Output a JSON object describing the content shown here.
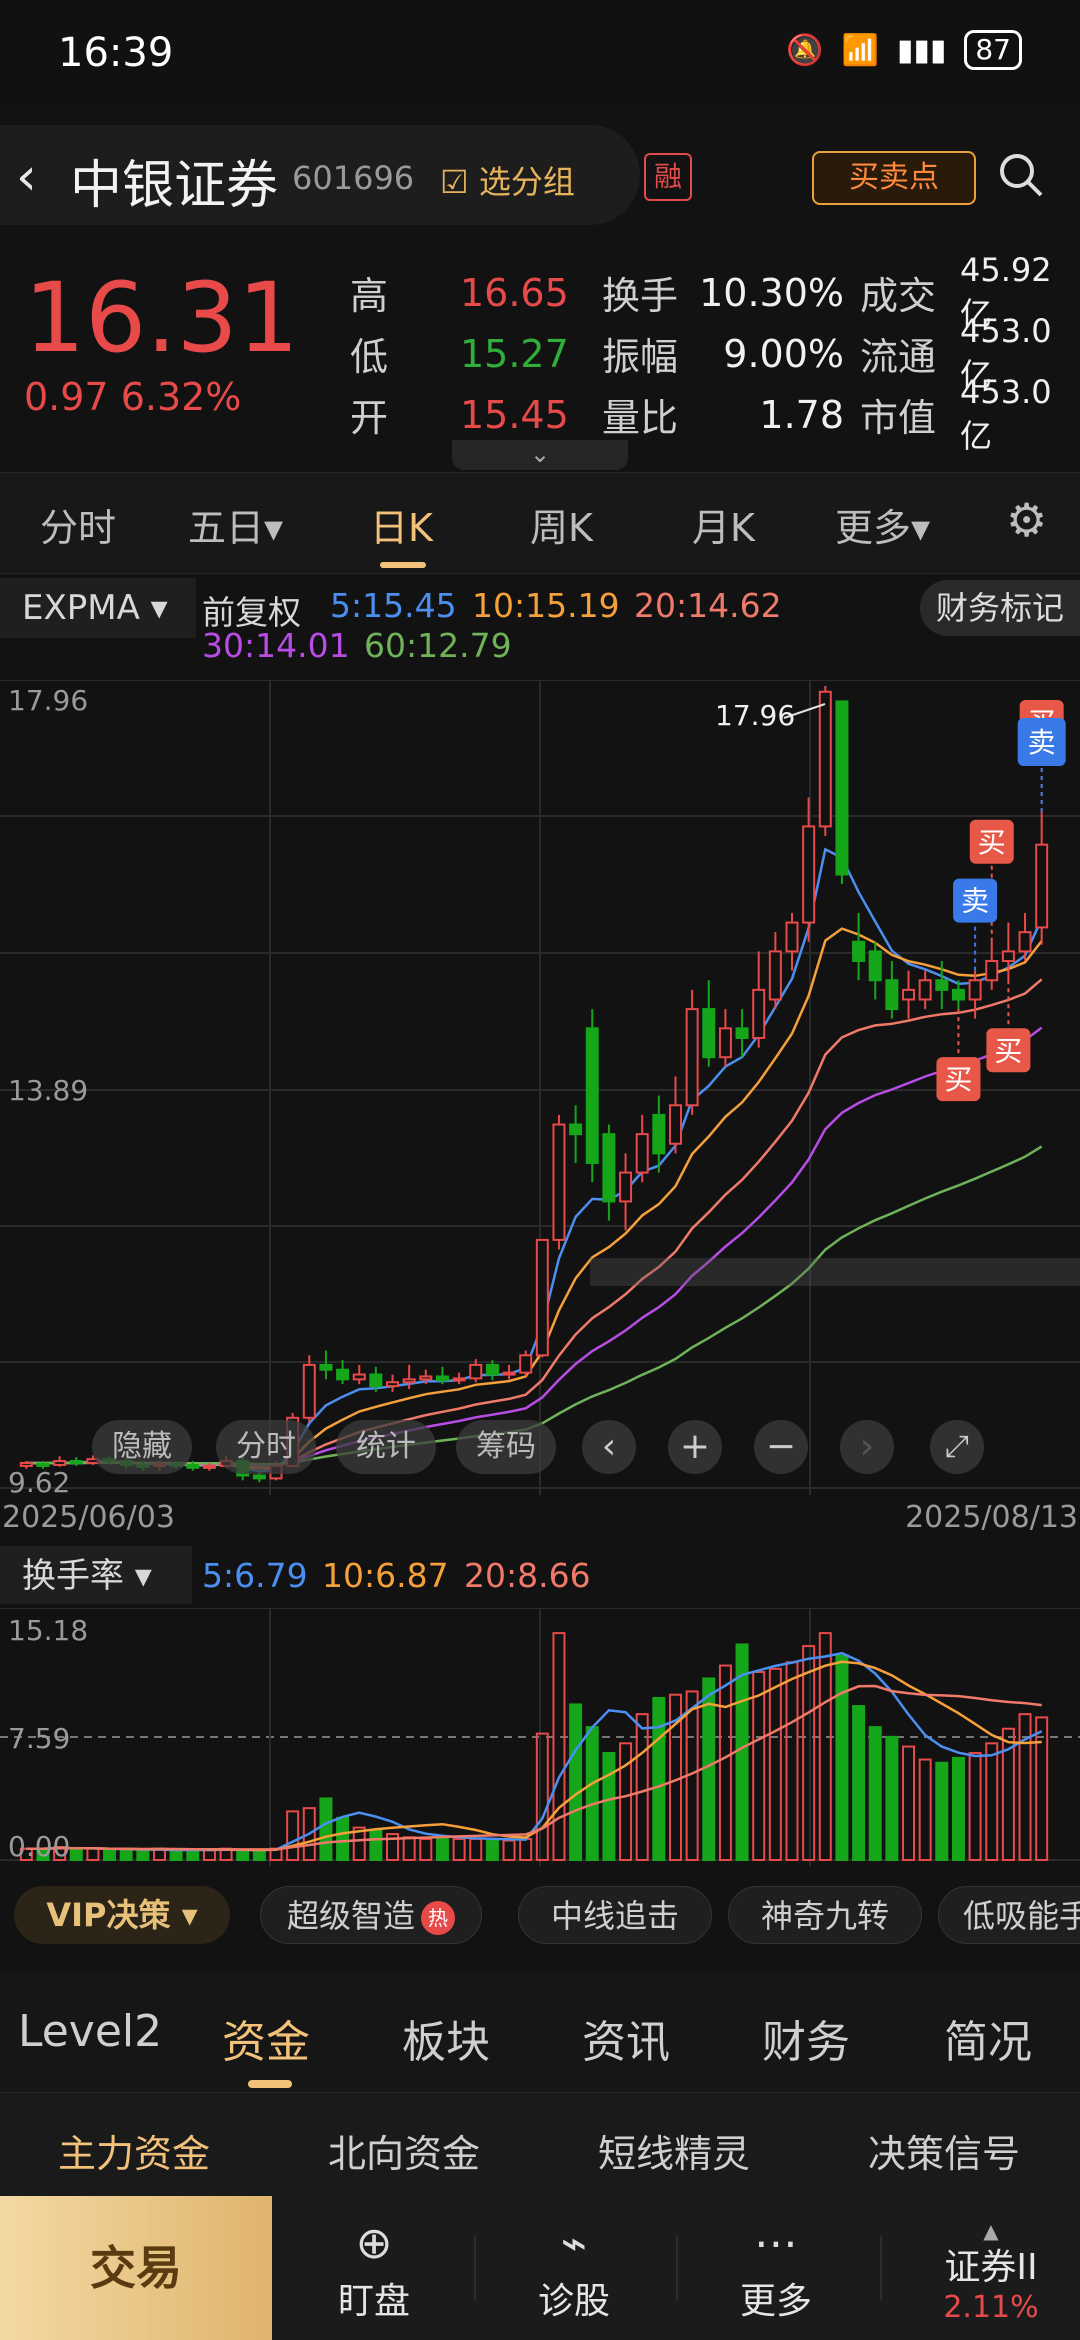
{
  "status": {
    "time": "16:39",
    "battery": "87"
  },
  "header": {
    "name": "中银证券",
    "code": "601696",
    "group": "选分组",
    "rong": "融",
    "bsp": "买卖点"
  },
  "quote": {
    "price": "16.31",
    "change": "0.97 6.32%",
    "rows": [
      {
        "l1": "高",
        "v1": "16.65",
        "l2": "换手",
        "v2": "10.30%",
        "l3": "成交",
        "v3": "45.92亿"
      },
      {
        "l1": "低",
        "v1": "15.27",
        "l2": "振幅",
        "v2": "9.00%",
        "l3": "流通",
        "v3": "453.0亿"
      },
      {
        "l1": "开",
        "v1": "15.45",
        "l2": "量比",
        "v2": "1.78",
        "l3": "市值",
        "v3": "453.0亿"
      }
    ]
  },
  "tabs": [
    "分时",
    "五日▾",
    "日K",
    "周K",
    "月K",
    "更多▾"
  ],
  "legend": {
    "indicator": "EXPMA ▾",
    "adjust": "前复权",
    "ma5": "5:15.45",
    "ma10": "10:15.19",
    "ma20": "20:14.62",
    "ma30": "30:14.01",
    "ma60": "60:12.79",
    "fin_mark": "财务标记"
  },
  "chart_labels": {
    "y_top": "17.96",
    "y_mid": "13.89",
    "y_low": "9.62",
    "peak": "17.96"
  },
  "chart_tools": {
    "hide": "隐藏",
    "timeshare": "分时",
    "stats": "统计",
    "chips": "筹码"
  },
  "signals": {
    "buy": "买",
    "sell": "卖"
  },
  "dates": {
    "start": "2025/06/03",
    "end": "2025/08/13"
  },
  "turnover": {
    "indicator": "换手率 ▾",
    "ma5": "5:6.79",
    "ma10": "10:6.87",
    "ma20": "20:8.66",
    "y_top": "15.18",
    "y_mid": "7.59",
    "y_low": "0.00"
  },
  "pills": {
    "vip": "VIP决策 ▾",
    "p1": "超级智造",
    "hot": "热",
    "p2": "中线追击",
    "p3": "神奇九转",
    "p4": "低吸能手"
  },
  "sections": [
    "Level2",
    "资金",
    "板块",
    "资讯",
    "财务",
    "简况"
  ],
  "subtabs": [
    "主力资金",
    "北向资金",
    "短线精灵",
    "决策信号"
  ],
  "bottom": {
    "trade": "交易",
    "watch": "盯盘",
    "diag": "诊股",
    "more": "更多",
    "broker": "证券II",
    "broker_pct": "2.11%"
  },
  "colors": {
    "up": "#e84a4a",
    "down": "#15a61a",
    "accent": "#f3c27a",
    "ma5": "#4b8ff0",
    "ma10": "#f5a03a",
    "ma20": "#f07a6a",
    "ma30": "#b84de6",
    "ma60": "#6fb25a"
  },
  "chart_data": [
    {
      "type": "candlestick",
      "title": "",
      "ylim": [
        9.62,
        17.96
      ],
      "x_range": [
        "2025/06/03",
        "2025/08/13"
      ],
      "candles": [
        [
          9.85,
          9.88,
          9.82,
          9.9
        ],
        [
          9.87,
          9.86,
          9.82,
          9.9
        ],
        [
          9.86,
          9.9,
          9.84,
          9.95
        ],
        [
          9.9,
          9.88,
          9.85,
          9.94
        ],
        [
          9.88,
          9.92,
          9.86,
          9.96
        ],
        [
          9.92,
          9.9,
          9.86,
          9.95
        ],
        [
          9.9,
          9.86,
          9.82,
          9.93
        ],
        [
          9.86,
          9.85,
          9.8,
          9.9
        ],
        [
          9.85,
          9.87,
          9.8,
          9.9
        ],
        [
          9.87,
          9.86,
          9.82,
          9.9
        ],
        [
          9.86,
          9.83,
          9.8,
          9.9
        ],
        [
          9.83,
          9.85,
          9.8,
          9.88
        ],
        [
          9.85,
          9.9,
          9.83,
          9.95
        ],
        [
          9.9,
          9.75,
          9.7,
          9.94
        ],
        [
          9.75,
          9.72,
          9.68,
          9.8
        ],
        [
          9.72,
          9.85,
          9.7,
          9.9
        ],
        [
          9.85,
          10.35,
          9.84,
          10.4
        ],
        [
          10.35,
          10.9,
          10.3,
          11.0
        ],
        [
          10.9,
          10.85,
          10.75,
          11.05
        ],
        [
          10.85,
          10.75,
          10.7,
          10.95
        ],
        [
          10.75,
          10.8,
          10.7,
          10.9
        ],
        [
          10.8,
          10.68,
          10.62,
          10.88
        ],
        [
          10.68,
          10.72,
          10.62,
          10.8
        ],
        [
          10.72,
          10.75,
          10.65,
          10.9
        ],
        [
          10.75,
          10.78,
          10.7,
          10.85
        ],
        [
          10.78,
          10.74,
          10.7,
          10.88
        ],
        [
          10.74,
          10.76,
          10.7,
          10.82
        ],
        [
          10.76,
          10.9,
          10.72,
          10.96
        ],
        [
          10.9,
          10.8,
          10.74,
          10.95
        ],
        [
          10.8,
          10.82,
          10.75,
          10.9
        ],
        [
          10.82,
          11.0,
          10.78,
          11.05
        ],
        [
          11.0,
          12.2,
          10.98,
          12.2
        ],
        [
          12.2,
          13.4,
          12.1,
          13.5
        ],
        [
          13.4,
          13.3,
          13.0,
          13.6
        ],
        [
          14.4,
          13.0,
          12.8,
          14.6
        ],
        [
          13.3,
          12.6,
          12.4,
          13.4
        ],
        [
          12.6,
          12.9,
          12.3,
          13.1
        ],
        [
          12.9,
          13.3,
          12.8,
          13.5
        ],
        [
          13.5,
          13.1,
          12.9,
          13.7
        ],
        [
          13.2,
          13.6,
          13.1,
          13.9
        ],
        [
          13.6,
          14.6,
          13.5,
          14.8
        ],
        [
          14.6,
          14.1,
          14.0,
          14.9
        ],
        [
          14.1,
          14.4,
          14.0,
          14.6
        ],
        [
          14.4,
          14.3,
          14.1,
          14.6
        ],
        [
          14.3,
          14.8,
          14.2,
          15.2
        ],
        [
          14.7,
          15.2,
          14.6,
          15.4
        ],
        [
          15.2,
          15.5,
          15.0,
          15.6
        ],
        [
          15.5,
          16.5,
          15.3,
          16.8
        ],
        [
          16.5,
          17.9,
          16.4,
          17.96
        ],
        [
          17.8,
          16.0,
          15.9,
          17.2
        ],
        [
          15.3,
          15.1,
          14.9,
          15.6
        ],
        [
          15.2,
          14.9,
          14.7,
          15.3
        ],
        [
          14.9,
          14.6,
          14.5,
          15.1
        ],
        [
          14.7,
          14.8,
          14.5,
          15.0
        ],
        [
          14.7,
          14.9,
          14.6,
          15.0
        ],
        [
          14.9,
          14.8,
          14.6,
          15.1
        ],
        [
          14.8,
          14.7,
          14.6,
          14.9
        ],
        [
          14.7,
          14.9,
          14.5,
          15.0
        ],
        [
          14.9,
          15.1,
          14.8,
          15.3
        ],
        [
          15.1,
          15.2,
          14.9,
          15.5
        ],
        [
          15.2,
          15.4,
          15.1,
          15.6
        ],
        [
          15.45,
          16.31,
          15.27,
          16.65
        ]
      ],
      "markers": [
        {
          "label": "买",
          "index": 50
        },
        {
          "label": "买",
          "index": 55
        },
        {
          "label": "买",
          "index": 57
        },
        {
          "label": "买",
          "index": 58
        },
        {
          "label": "卖",
          "index": 61
        },
        {
          "label": "卖",
          "index": 57
        }
      ]
    },
    {
      "type": "bar",
      "title": "",
      "ylabel": "",
      "ylim": [
        0,
        15.18
      ],
      "values": [
        0.7,
        0.7,
        0.8,
        0.7,
        0.7,
        0.6,
        0.6,
        0.6,
        0.7,
        0.6,
        0.6,
        0.6,
        0.7,
        0.6,
        0.6,
        0.7,
        3.0,
        3.2,
        3.8,
        2.6,
        2.0,
        1.8,
        1.6,
        1.4,
        1.3,
        1.4,
        1.3,
        1.3,
        1.2,
        1.2,
        1.3,
        7.8,
        14.0,
        9.6,
        8.2,
        6.6,
        7.2,
        9.0,
        10.0,
        10.2,
        10.4,
        11.2,
        12.0,
        13.3,
        11.6,
        11.8,
        12.2,
        13.2,
        14.0,
        12.6,
        9.5,
        8.2,
        7.6,
        7.0,
        6.2,
        6.0,
        6.3,
        6.6,
        7.2,
        8.1,
        9.0,
        8.8
      ]
    }
  ]
}
